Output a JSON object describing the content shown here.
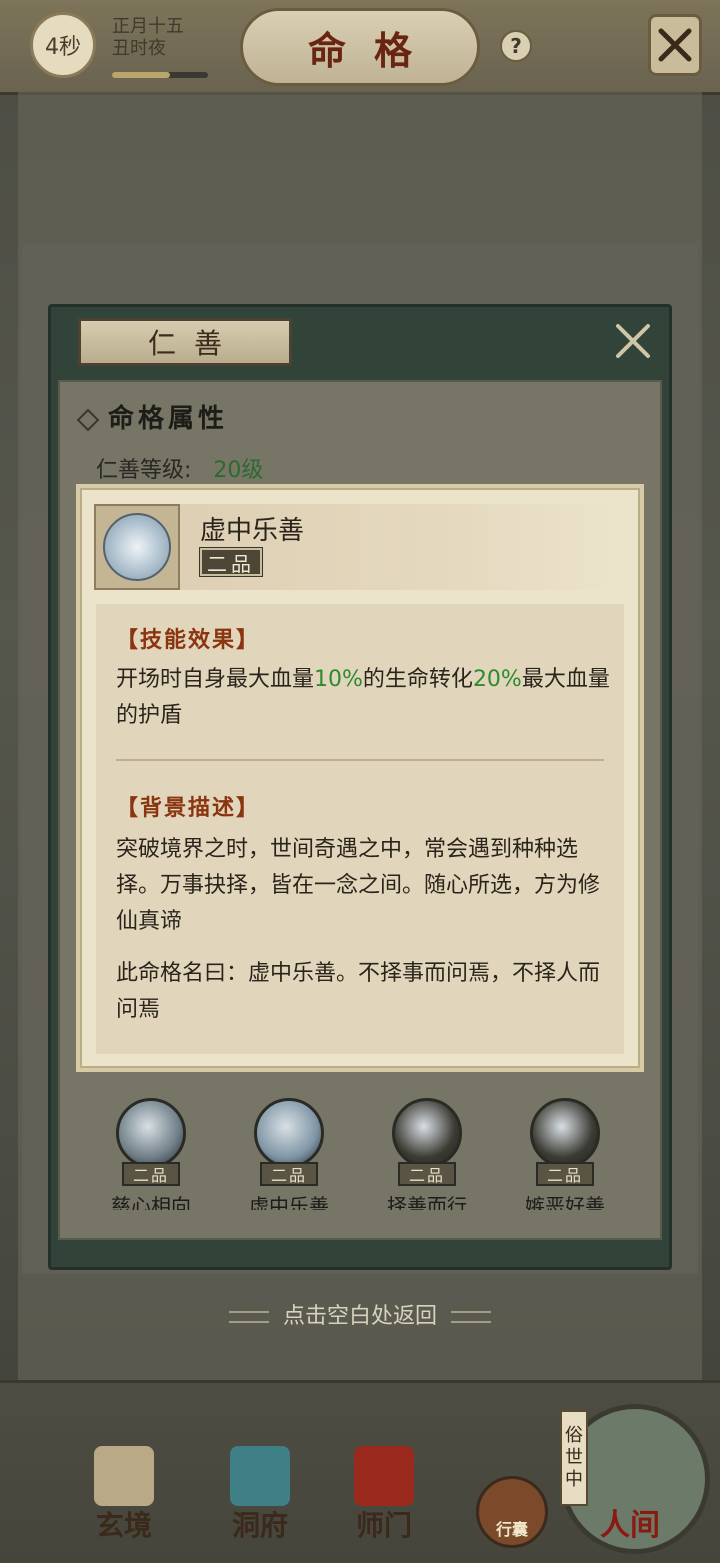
{
  "header": {
    "timer": "4秒",
    "date_line1": "正月十五",
    "date_line2": "丑时夜",
    "time_progress": 0.6,
    "title": "命格",
    "help_glyph": "?"
  },
  "dialog": {
    "name": "仁善",
    "section_title": "命格属性",
    "level_label": "仁善等级:",
    "level_value": "20级"
  },
  "tooltip": {
    "skill_name": "虚中乐善",
    "grade": "二品",
    "effect_header": "【技能效果】",
    "effect_part1": "开场时自身最大血量",
    "effect_pct1": "10%",
    "effect_part2": "的生命转化",
    "effect_pct2": "20%",
    "effect_part3": "最大血量的护盾",
    "bg_header": "【背景描述】",
    "bg_text1": "突破境界之时，世间奇遇之中，常会遇到种种选择。万事抉择，皆在一念之间。随心所选，方为修仙真谛",
    "bg_text2": "此命格名曰：虚中乐善。不择事而问焉，不择人而问焉"
  },
  "skills": [
    {
      "name": "慈心相向",
      "grade": "二品",
      "color": "#6f7e88"
    },
    {
      "name": "虚中乐善",
      "grade": "二品",
      "color": "#7f95a6"
    },
    {
      "name": "择善而行",
      "grade": "二品",
      "color": "#3b3a33"
    },
    {
      "name": "嫉恶好善",
      "grade": "二品",
      "color": "#3b3a33"
    }
  ],
  "return_hint": "点击空白处返回",
  "nav": {
    "items": [
      {
        "label": "玄境"
      },
      {
        "label": "洞府"
      },
      {
        "label": "师门"
      }
    ],
    "bag_label": "行囊",
    "world_tag": [
      "俗",
      "世",
      "中"
    ],
    "world_label": "人间"
  },
  "colors": {
    "accent_green": "#2f8a2f",
    "header_red": "#8a3410",
    "title_red": "#6a2414"
  }
}
